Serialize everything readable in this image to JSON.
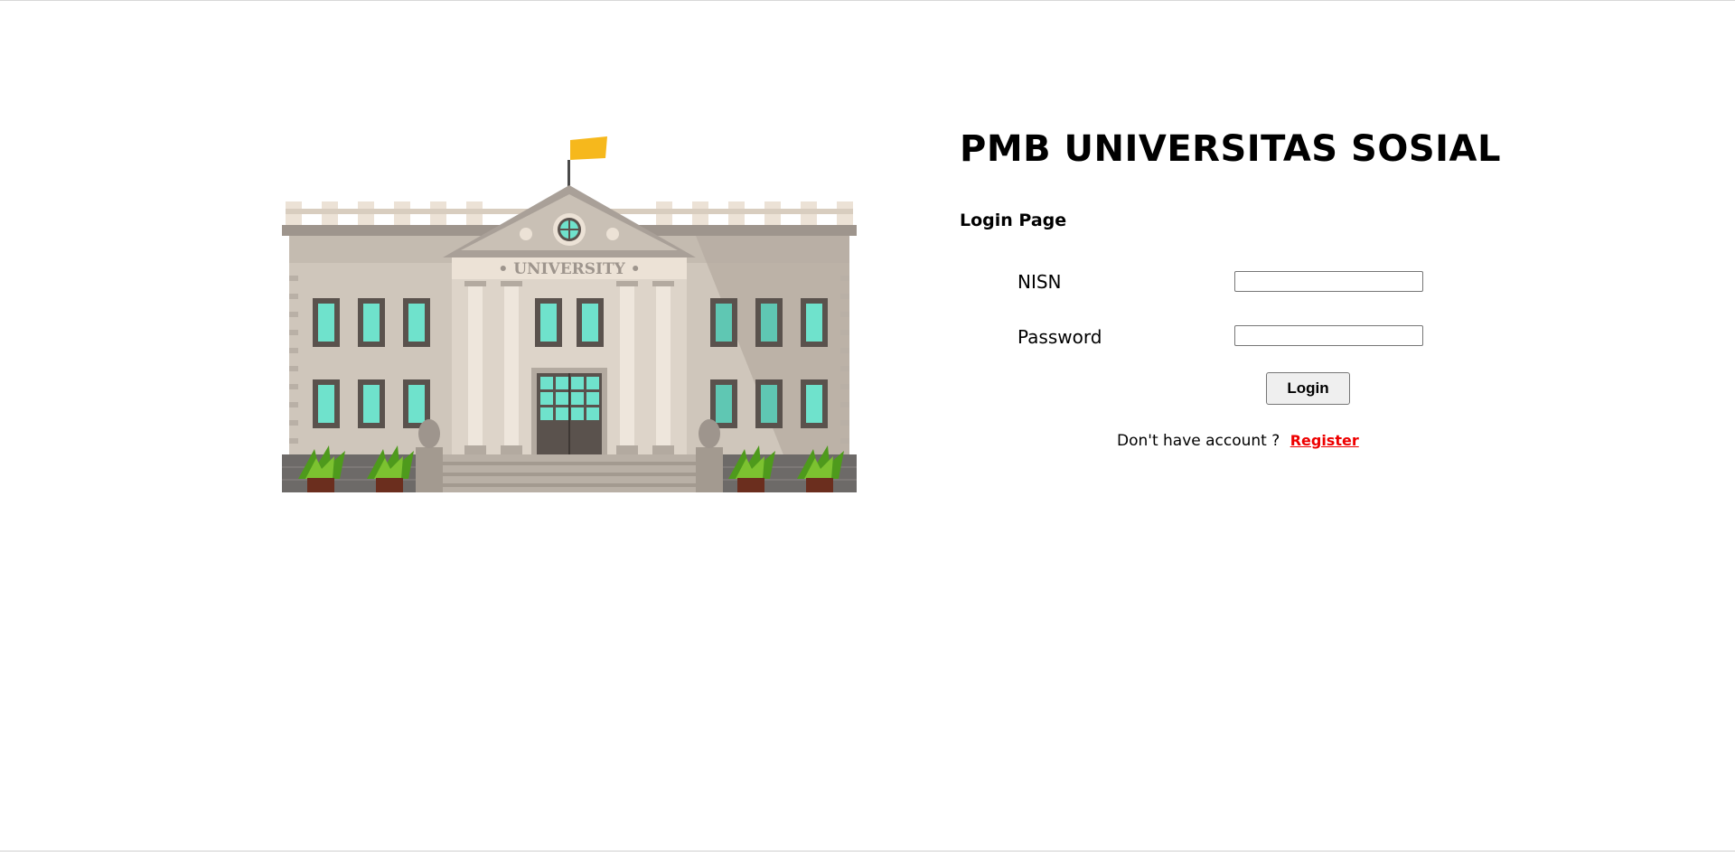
{
  "header": {
    "title": "PMB UNIVERSITAS SOSIAL",
    "subtitle": "Login Page"
  },
  "illustration": {
    "sign_text": "• UNIVERSITY •",
    "colors": {
      "flag": "#f6b81c",
      "window": "#6fe2cc",
      "wall": "#cfc6bb",
      "roof": "#a9a098",
      "plant": "#4e9a1c",
      "stone": "#6d6a68"
    }
  },
  "form": {
    "nisn_label": "NISN",
    "nisn_value": "",
    "password_label": "Password",
    "password_value": "",
    "login_label": "Login"
  },
  "footer": {
    "prompt": "Don't have account ?",
    "register_label": "Register"
  },
  "colors": {
    "link": "#ee0000",
    "button_bg": "#efefef"
  }
}
